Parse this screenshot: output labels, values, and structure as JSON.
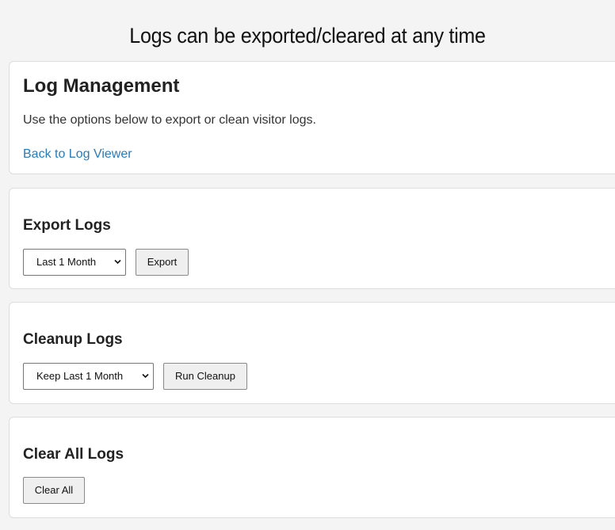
{
  "caption": "Logs can be exported/cleared at any time",
  "intro": {
    "title": "Log Management",
    "description": "Use the options below to export or clean visitor logs.",
    "back_link": "Back to Log Viewer"
  },
  "export": {
    "title": "Export Logs",
    "select_value": "Last 1 Month",
    "button_label": "Export"
  },
  "cleanup": {
    "title": "Cleanup Logs",
    "select_value": "Keep Last 1 Month",
    "button_label": "Run Cleanup"
  },
  "clear": {
    "title": "Clear All Logs",
    "button_label": "Clear All"
  },
  "icons": {
    "select_arrow": "chevron-down-icon"
  },
  "colors": {
    "link": "#2a7ab8",
    "background": "#f4f4f4",
    "card": "#ffffff"
  }
}
